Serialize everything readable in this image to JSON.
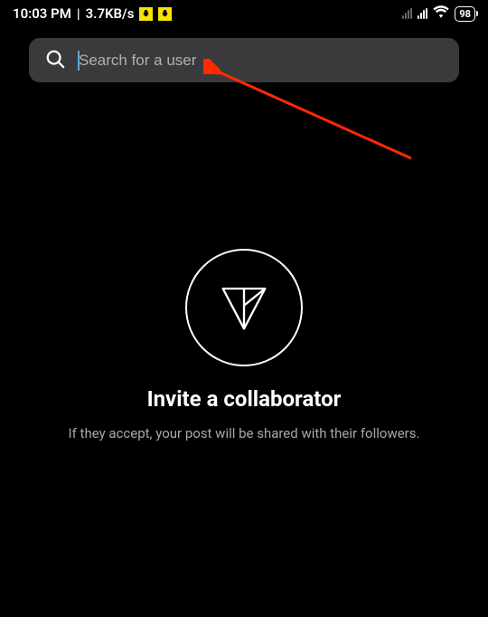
{
  "status_bar": {
    "time": "10:03 PM",
    "separator": "|",
    "net_speed": "3.7KB/s",
    "battery_level": "98"
  },
  "search": {
    "placeholder": "Search for a user"
  },
  "empty_state": {
    "title": "Invite a collaborator",
    "subtitle": "If they accept, your post will be shared with their followers."
  }
}
